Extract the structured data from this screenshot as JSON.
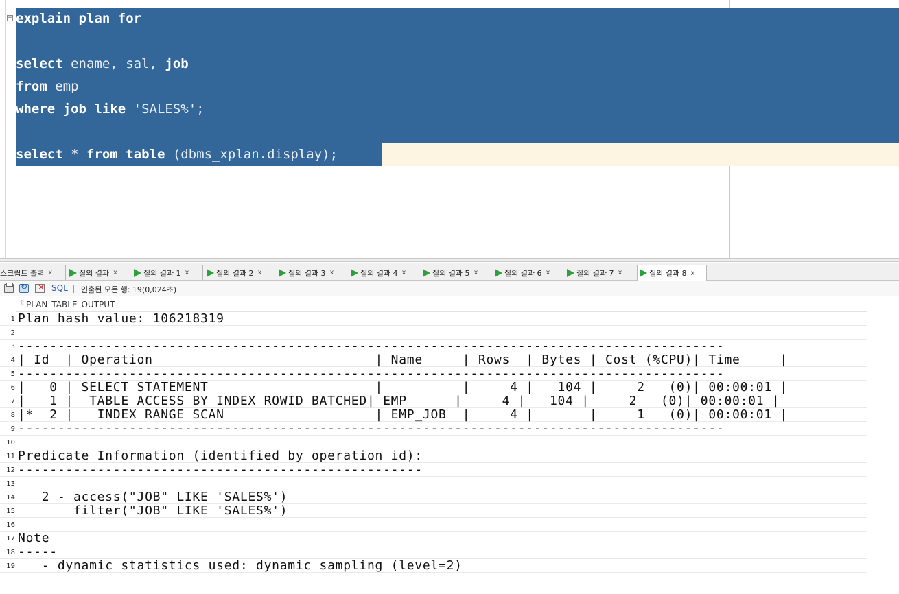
{
  "editor": {
    "lines": [
      [
        {
          "t": "explain",
          "k": 1
        },
        {
          "t": " "
        },
        {
          "t": "plan",
          "k": 1
        },
        {
          "t": " "
        },
        {
          "t": "for",
          "k": 1
        }
      ],
      [],
      [
        {
          "t": "select",
          "k": 1
        },
        {
          "t": " ename, sal, "
        },
        {
          "t": "job",
          "k": 1
        }
      ],
      [
        {
          "t": "from",
          "k": 1
        },
        {
          "t": " emp"
        }
      ],
      [
        {
          "t": "where",
          "k": 1
        },
        {
          "t": " "
        },
        {
          "t": "job",
          "k": 1
        },
        {
          "t": " "
        },
        {
          "t": "like",
          "k": 1
        },
        {
          "t": " 'SALES%';"
        }
      ],
      [],
      [
        {
          "t": "select",
          "k": 1
        },
        {
          "t": " * "
        },
        {
          "t": "from",
          "k": 1
        },
        {
          "t": " "
        },
        {
          "t": "table",
          "k": 1
        },
        {
          "t": " (dbms_xplan.display);"
        }
      ]
    ]
  },
  "tabs": [
    {
      "label": "스크립트 출력",
      "play": false,
      "active": false
    },
    {
      "label": "질의 결과",
      "play": true,
      "active": false
    },
    {
      "label": "질의 결과 1",
      "play": true,
      "active": false
    },
    {
      "label": "질의 결과 2",
      "play": true,
      "active": false
    },
    {
      "label": "질의 결과 3",
      "play": true,
      "active": false
    },
    {
      "label": "질의 결과 4",
      "play": true,
      "active": false
    },
    {
      "label": "질의 결과 5",
      "play": true,
      "active": false
    },
    {
      "label": "질의 결과 6",
      "play": true,
      "active": false
    },
    {
      "label": "질의 결과 7",
      "play": true,
      "active": false
    },
    {
      "label": "질의 결과 8",
      "play": true,
      "active": true
    }
  ],
  "tab_close_glyph": "x",
  "toolbar": {
    "sql_label": "SQL",
    "status": "인출된 모든 행: 19(0,024초)"
  },
  "grid": {
    "column": "PLAN_TABLE_OUTPUT",
    "rows": [
      "Plan hash value: 106218319",
      "",
      "-----------------------------------------------------------------------------------------",
      "| Id  | Operation                            | Name     | Rows  | Bytes | Cost (%CPU)| Time     |",
      "-----------------------------------------------------------------------------------------",
      "|   0 | SELECT STATEMENT                     |          |     4 |   104 |     2   (0)| 00:00:01 |",
      "|   1 |  TABLE ACCESS BY INDEX ROWID BATCHED| EMP      |     4 |   104 |     2   (0)| 00:00:01 |",
      "|*  2 |   INDEX RANGE SCAN                   | EMP_JOB  |     4 |       |     1   (0)| 00:00:01 |",
      "-----------------------------------------------------------------------------------------",
      "",
      "Predicate Information (identified by operation id):",
      "---------------------------------------------------",
      "",
      "   2 - access(\"JOB\" LIKE 'SALES%')",
      "       filter(\"JOB\" LIKE 'SALES%')",
      "",
      "Note",
      "-----",
      "   - dynamic statistics used: dynamic sampling (level=2)"
    ]
  }
}
